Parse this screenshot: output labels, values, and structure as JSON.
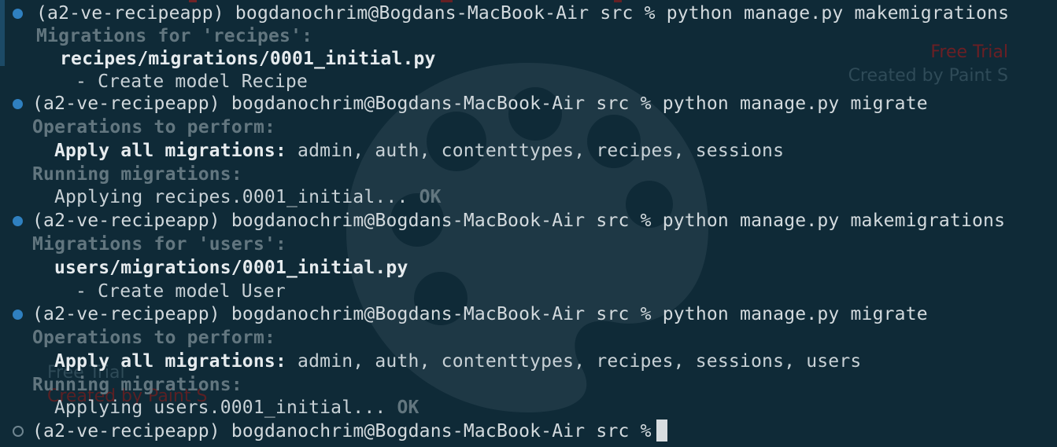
{
  "watermark": {
    "top_right_line1": "Free Trial",
    "top_right_line2": "Created by Paint S",
    "bottom_left_line1": "Free Trial",
    "bottom_left_line2": "Created by Paint S",
    "colors": {
      "red": "#6b1f24",
      "grey": "#2f4b58"
    }
  },
  "theme": {
    "background": "#0f2a37",
    "dot_active": "#2f80c0",
    "dim_text": "#62767f",
    "text": "#c8d1d6"
  },
  "lines": [
    {
      "prompt": "(a2-ve-recipeapp) bogdanochrim@Bogdans-MacBook-Air src % python manage.py makemigrations"
    },
    {
      "text": "Migrations for 'recipes':"
    },
    {
      "text": "recipes/migrations/0001_initial.py"
    },
    {
      "text": "- Create model Recipe"
    },
    {
      "prompt": "(a2-ve-recipeapp) bogdanochrim@Bogdans-MacBook-Air src % python manage.py migrate"
    },
    {
      "text": "Operations to perform:"
    },
    {
      "label": "Apply all migrations:",
      "value": " admin, auth, contenttypes, recipes, sessions"
    },
    {
      "text": "Running migrations:"
    },
    {
      "text": "Applying recipes.0001_initial...",
      "ok": " OK"
    },
    {
      "prompt": "(a2-ve-recipeapp) bogdanochrim@Bogdans-MacBook-Air src % python manage.py makemigrations"
    },
    {
      "text": "Migrations for 'users':"
    },
    {
      "text": "users/migrations/0001_initial.py"
    },
    {
      "text": "- Create model User"
    },
    {
      "prompt": "(a2-ve-recipeapp) bogdanochrim@Bogdans-MacBook-Air src % python manage.py migrate"
    },
    {
      "text": "Operations to perform:"
    },
    {
      "label": "Apply all migrations:",
      "value": " admin, auth, contenttypes, recipes, sessions, users"
    },
    {
      "text": "Running migrations:"
    },
    {
      "text": "Applying users.0001_initial...",
      "ok": " OK"
    },
    {
      "prompt": "(a2-ve-recipeapp) bogdanochrim@Bogdans-MacBook-Air src %"
    }
  ]
}
